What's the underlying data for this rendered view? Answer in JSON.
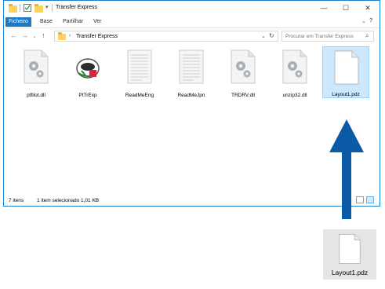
{
  "window": {
    "title": "Transfer Express",
    "controls": {
      "minimize": "—",
      "maximize": "☐",
      "close": "✕"
    }
  },
  "ribbon": {
    "tabs": [
      "Ficheiro",
      "Base",
      "Partilhar",
      "Ver"
    ],
    "collapse_icon": "chevron-down-icon",
    "help_icon": "?"
  },
  "address": {
    "path": "Transfer Express",
    "search_placeholder": "Procurar em Transfer Express"
  },
  "files": [
    {
      "name": "ptfilot.dll",
      "icon": "dll-gear-icon"
    },
    {
      "name": "PtTrExp",
      "icon": "app-icon"
    },
    {
      "name": "ReadMeEng",
      "icon": "text-doc-icon"
    },
    {
      "name": "ReadMeJpn",
      "icon": "text-doc-icon"
    },
    {
      "name": "TRDRV.dll",
      "icon": "dll-gear-icon"
    },
    {
      "name": "unzip32.dll",
      "icon": "dll-gear-icon"
    },
    {
      "name": "Layout1.pdz",
      "icon": "blank-doc-icon",
      "selected": true
    }
  ],
  "status": {
    "count": "7 itens",
    "selection": "1 item selecionado 1,01 KB"
  },
  "dragged_file": {
    "name": "Layout1.pdz"
  },
  "colors": {
    "accent": "#1979ca",
    "arrow": "#0b5aa6",
    "selection": "#cce8ff"
  }
}
